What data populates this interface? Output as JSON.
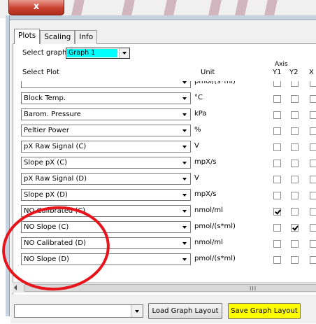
{
  "window": {
    "close_glyph": "x"
  },
  "tabs": [
    {
      "label": "Plots",
      "active": true
    },
    {
      "label": "Scaling",
      "active": false
    },
    {
      "label": "Info",
      "active": false
    }
  ],
  "select_graph": {
    "label": "Select graph",
    "value": "Graph 1"
  },
  "headers": {
    "select_plot": "Select Plot",
    "unit": "Unit",
    "axis": "Axis",
    "y1": "Y1",
    "y2": "Y2",
    "x": "X"
  },
  "rows": [
    {
      "plot": "",
      "unit": "pmol/(s*ml)",
      "y1": false,
      "y2": false,
      "x": false
    },
    {
      "plot": "Block Temp.",
      "unit": "°C",
      "y1": false,
      "y2": false,
      "x": false
    },
    {
      "plot": "Barom. Pressure",
      "unit": "kPa",
      "y1": false,
      "y2": false,
      "x": false
    },
    {
      "plot": "Peltier Power",
      "unit": "%",
      "y1": false,
      "y2": false,
      "x": false
    },
    {
      "plot": "pX Raw Signal (C)",
      "unit": "V",
      "y1": false,
      "y2": false,
      "x": false
    },
    {
      "plot": "Slope pX (C)",
      "unit": "mpX/s",
      "y1": false,
      "y2": false,
      "x": false
    },
    {
      "plot": "pX Raw Signal (D)",
      "unit": "V",
      "y1": false,
      "y2": false,
      "x": false
    },
    {
      "plot": "Slope pX (D)",
      "unit": "mpX/s",
      "y1": false,
      "y2": false,
      "x": false
    },
    {
      "plot": "NO Calibrated (C)",
      "unit": "nmol/ml",
      "y1": true,
      "y2": false,
      "x": false
    },
    {
      "plot": "NO Slope (C)",
      "unit": "pmol/(s*ml)",
      "y1": false,
      "y2": true,
      "x": false
    },
    {
      "plot": "NO Calibrated (D)",
      "unit": "nmol/ml",
      "y1": false,
      "y2": false,
      "x": false
    },
    {
      "plot": "NO Slope (D)",
      "unit": "pmol/(s*ml)",
      "y1": false,
      "y2": false,
      "x": false
    }
  ],
  "scrollbar": {
    "grip": "III"
  },
  "bottom": {
    "layout_value": "",
    "load_label": "Load Graph Layout",
    "save_label": "Save Graph Layout"
  },
  "colors": {
    "graph_highlight": "#00ffff",
    "save_button": "#ffff00",
    "annotation": "#e8141c"
  }
}
